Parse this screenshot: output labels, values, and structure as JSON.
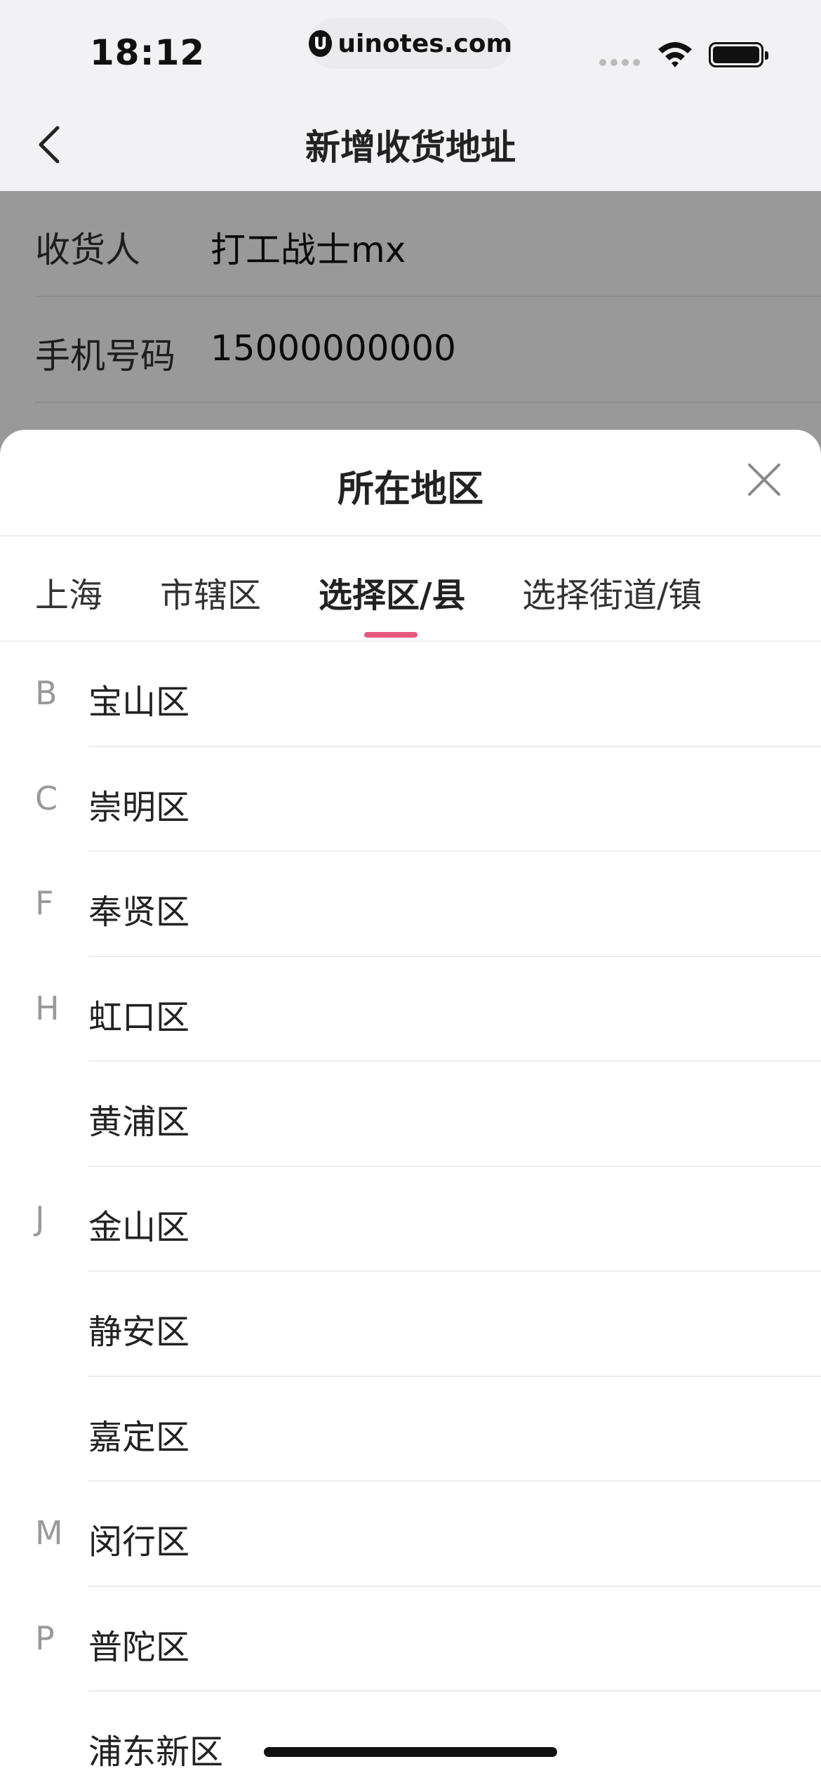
{
  "status_bar": {
    "time": "18:12",
    "url": "uinotes.com",
    "url_logo": "U"
  },
  "nav": {
    "title": "新增收货地址"
  },
  "form": {
    "rows": [
      {
        "label": "收货人",
        "value": "打工战士mx"
      },
      {
        "label": "手机号码",
        "value": "15000000000"
      }
    ]
  },
  "sheet": {
    "title": "所在地区",
    "tabs": [
      {
        "label": "上海"
      },
      {
        "label": "市辖区"
      },
      {
        "label": "选择区/县"
      },
      {
        "label": "选择街道/镇"
      }
    ],
    "active_tab_index": 2,
    "accent_color": "#e8577e",
    "items": [
      {
        "letter": "B",
        "name": "宝山区"
      },
      {
        "letter": "C",
        "name": "崇明区"
      },
      {
        "letter": "F",
        "name": "奉贤区"
      },
      {
        "letter": "H",
        "name": "虹口区"
      },
      {
        "letter": "",
        "name": "黄浦区"
      },
      {
        "letter": "J",
        "name": "金山区"
      },
      {
        "letter": "",
        "name": "静安区"
      },
      {
        "letter": "",
        "name": "嘉定区"
      },
      {
        "letter": "M",
        "name": "闵行区"
      },
      {
        "letter": "P",
        "name": "普陀区"
      },
      {
        "letter": "",
        "name": "浦东新区"
      }
    ]
  }
}
